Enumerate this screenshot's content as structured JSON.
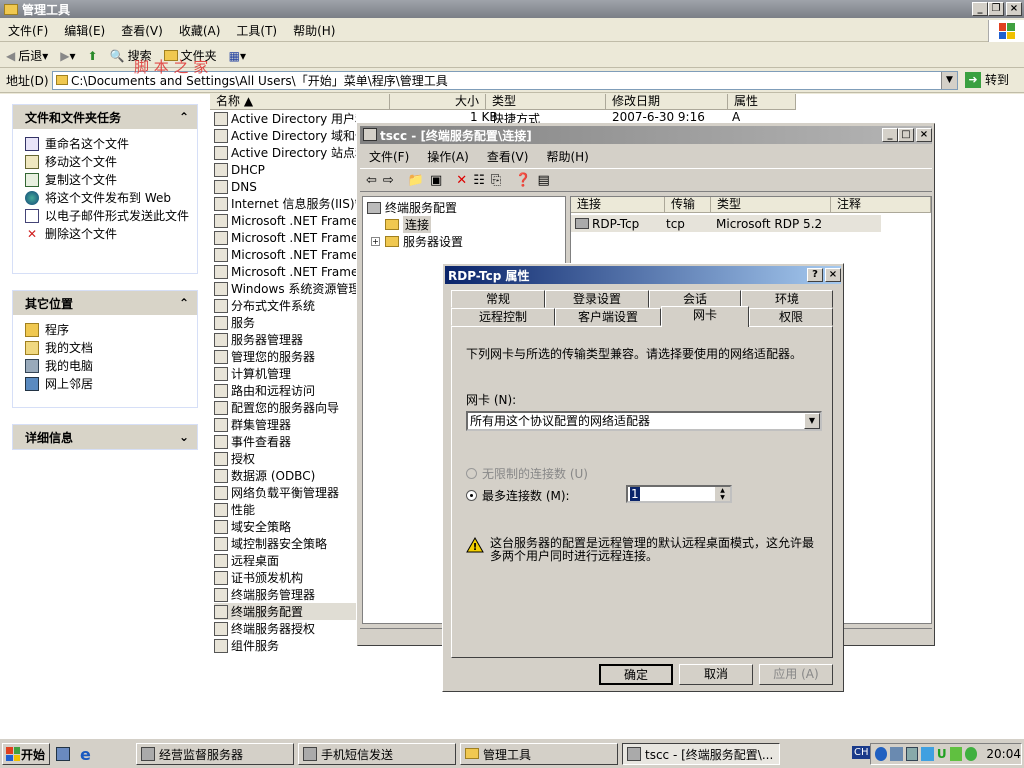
{
  "window": {
    "title": "管理工具"
  },
  "menu": [
    "文件(F)",
    "编辑(E)",
    "查看(V)",
    "收藏(A)",
    "工具(T)",
    "帮助(H)"
  ],
  "toolbar": {
    "back": "后退",
    "search": "搜索",
    "folders": "文件夹"
  },
  "address": {
    "label": "地址(D)",
    "value": "C:\\Documents and Settings\\All Users\\「开始」菜单\\程序\\管理工具",
    "go": "转到"
  },
  "watermark": "脚 本 之 家",
  "left": {
    "file_tasks": {
      "title": "文件和文件夹任务",
      "items": [
        "重命名这个文件",
        "移动这个文件",
        "复制这个文件",
        "将这个文件发布到 Web",
        "以电子邮件形式发送此文件",
        "删除这个文件"
      ]
    },
    "other_places": {
      "title": "其它位置",
      "items": [
        "程序",
        "我的文档",
        "我的电脑",
        "网上邻居"
      ]
    },
    "details": {
      "title": "详细信息"
    }
  },
  "columns": [
    "名称",
    "大小",
    "类型",
    "修改日期",
    "属性"
  ],
  "first_row": {
    "size": "1 KB",
    "type": "快捷方式",
    "date": "2007-6-30 9:16",
    "attr": "A"
  },
  "files": [
    "Active Directory 用户和计算机",
    "Active Directory 域和信任关系",
    "Active Directory 站点和服务",
    "DHCP",
    "DNS",
    "Internet 信息服务(IIS)管理器",
    "Microsoft .NET Framework",
    "Microsoft .NET Framework",
    "Microsoft .NET Framework",
    "Microsoft .NET Framework",
    "Windows 系统资源管理器",
    "分布式文件系统",
    "服务",
    "服务器管理器",
    "管理您的服务器",
    "计算机管理",
    "路由和远程访问",
    "配置您的服务器向导",
    "群集管理器",
    "事件查看器",
    "授权",
    "数据源 (ODBC)",
    "网络负载平衡管理器",
    "性能",
    "域安全策略",
    "域控制器安全策略",
    "远程桌面",
    "证书颁发机构",
    "终端服务管理器",
    "终端服务配置",
    "终端服务器授权",
    "组件服务"
  ],
  "mmc": {
    "title": "tscc - [终端服务配置\\连接]",
    "menu": [
      "文件(F)",
      "操作(A)",
      "查看(V)",
      "帮助(H)"
    ],
    "tree": {
      "root": "终端服务配置",
      "child1": "连接",
      "child2": "服务器设置"
    },
    "columns": [
      "连接",
      "传输",
      "类型",
      "注释"
    ],
    "row": {
      "name": "RDP-Tcp",
      "transport": "tcp",
      "type": "Microsoft RDP 5.2",
      "comment": ""
    }
  },
  "dialog": {
    "title": "RDP-Tcp 属性",
    "tabs_row1": [
      "常规",
      "登录设置",
      "会话",
      "环境"
    ],
    "tabs_row2": [
      "远程控制",
      "客户端设置",
      "网卡",
      "权限"
    ],
    "desc": "下列网卡与所选的传输类型兼容。请选择要使用的网络适配器。",
    "nic_label": "网卡 (N):",
    "nic_value": "所有用这个协议配置的网络适配器",
    "radio_unlimited": "无限制的连接数 (U)",
    "radio_max": "最多连接数 (M):",
    "max_value": "1",
    "warning": "这台服务器的配置是远程管理的默认远程桌面模式，这允许最多两个用户同时进行远程连接。",
    "ok": "确定",
    "cancel": "取消",
    "apply": "应用 (A)"
  },
  "taskbar": {
    "start": "开始",
    "items": [
      "经营监督服务器",
      "手机短信发送",
      "管理工具",
      "tscc - [终端服务配置\\..."
    ],
    "lang": "CH",
    "clock": "20:04"
  }
}
